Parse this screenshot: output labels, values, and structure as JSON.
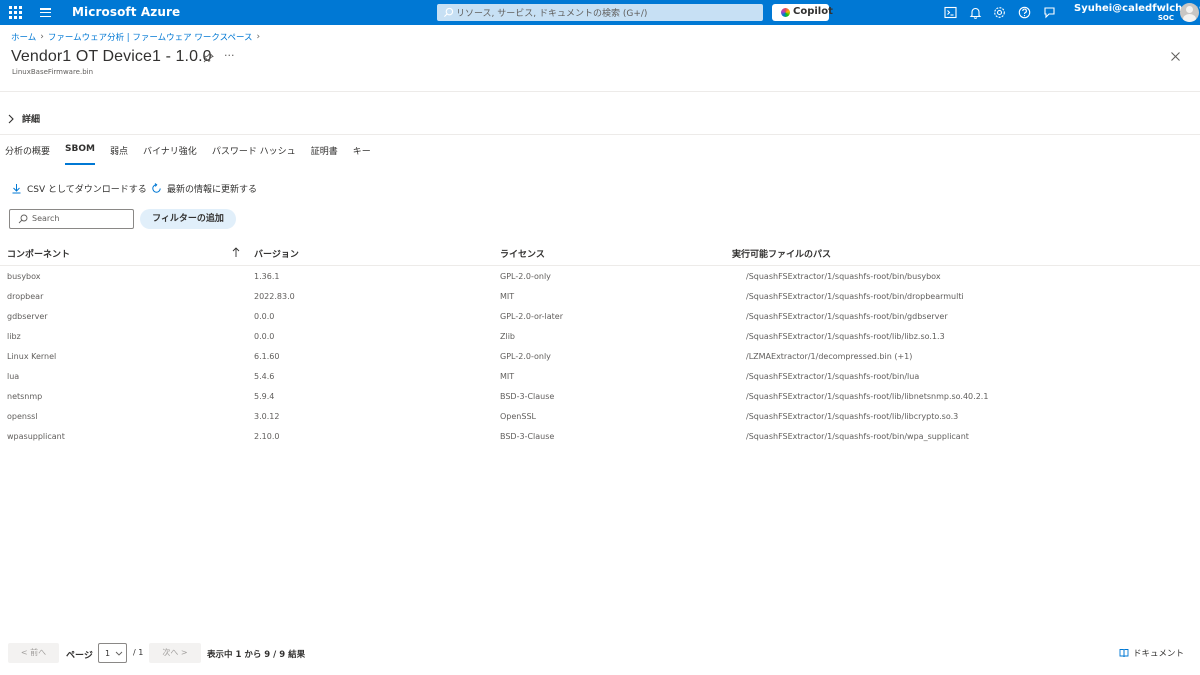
{
  "topbar": {
    "brand": "Microsoft Azure",
    "search_placeholder": "リソース, サービス, ドキュメントの検索 (G+/)",
    "copilot_label": "Copilot",
    "user_name": "Syuhei@caledfwlch.t···",
    "user_org": "SOC",
    "icons": [
      "cloud-shell-icon",
      "notifications-icon",
      "settings-icon",
      "help-icon",
      "feedback-icon"
    ]
  },
  "breadcrumb": [
    "ホーム",
    "ファームウェア分析 | ファームウェア ワークスペース"
  ],
  "page": {
    "title": "Vendor1 OT Device1 - 1.0.0",
    "subtitle": "LinuxBaseFirmware.bin",
    "more": "···"
  },
  "details_label": "詳細",
  "tabs": [
    "分析の概要",
    "SBOM",
    "弱点",
    "バイナリ強化",
    "パスワード ハッシュ",
    "証明書",
    "キー"
  ],
  "active_tab": "SBOM",
  "commands": {
    "download": "CSV としてダウンロードする",
    "refresh": "最新の情報に更新する"
  },
  "search": {
    "placeholder": "Search"
  },
  "filter_label": "フィルターの追加",
  "table": {
    "headers": [
      "コンポーネント",
      "バージョン",
      "ライセンス",
      "実行可能ファイルのパス"
    ],
    "rows": [
      [
        "busybox",
        "1.36.1",
        "GPL-2.0-only",
        "/SquashFSExtractor/1/squashfs-root/bin/busybox"
      ],
      [
        "dropbear",
        "2022.83.0",
        "MIT",
        "/SquashFSExtractor/1/squashfs-root/bin/dropbearmulti"
      ],
      [
        "gdbserver",
        "0.0.0",
        "GPL-2.0-or-later",
        "/SquashFSExtractor/1/squashfs-root/bin/gdbserver"
      ],
      [
        "libz",
        "0.0.0",
        "Zlib",
        "/SquashFSExtractor/1/squashfs-root/lib/libz.so.1.3"
      ],
      [
        "Linux Kernel",
        "6.1.60",
        "GPL-2.0-only",
        "/LZMAExtractor/1/decompressed.bin (+1)"
      ],
      [
        "lua",
        "5.4.6",
        "MIT",
        "/SquashFSExtractor/1/squashfs-root/bin/lua"
      ],
      [
        "netsnmp",
        "5.9.4",
        "BSD-3-Clause",
        "/SquashFSExtractor/1/squashfs-root/lib/libnetsnmp.so.40.2.1"
      ],
      [
        "openssl",
        "3.0.12",
        "OpenSSL",
        "/SquashFSExtractor/1/squashfs-root/lib/libcrypto.so.3"
      ],
      [
        "wpasupplicant",
        "2.10.0",
        "BSD-3-Clause",
        "/SquashFSExtractor/1/squashfs-root/bin/wpa_supplicant"
      ]
    ]
  },
  "pager": {
    "prev": "< 前へ",
    "page_label": "ページ",
    "page_value": "1",
    "total": "/ 1",
    "next": "次へ >",
    "summary": "表示中 1 から 9 / 9 結果"
  },
  "doc_link": "ドキュメント",
  "colors": {
    "accent": "#0078d4",
    "topbar": "#0078d4"
  }
}
